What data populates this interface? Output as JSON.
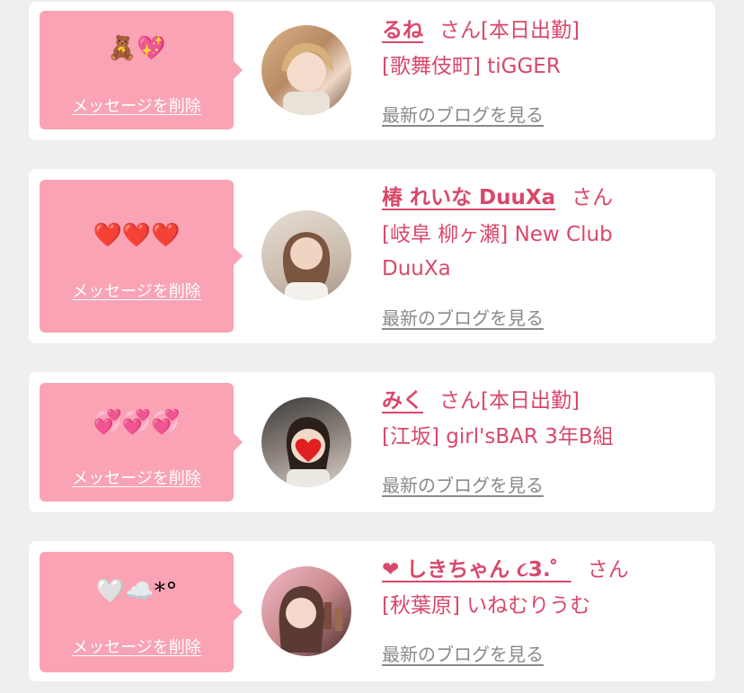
{
  "colors": {
    "accent": "#d9486a",
    "bubble": "#f9a3b4",
    "muted": "#8a8a8a",
    "background": "#efefef"
  },
  "entries": [
    {
      "emoji": "🧸💖",
      "delete_label": "メッセージを削除",
      "name": "るね",
      "suffix": "さん[本日出勤]",
      "shop": "[歌舞伎町] tiGGER",
      "blog_label": "最新のブログを見る"
    },
    {
      "emoji": "❤️❤️❤️",
      "delete_label": "メッセージを削除",
      "name": "椿 れいな DuuXa",
      "suffix": "さん",
      "shop": "[岐阜 柳ヶ瀬] New Club DuuXa",
      "blog_label": "最新のブログを見る"
    },
    {
      "emoji": "💞💞💞",
      "delete_label": "メッセージを削除",
      "name": "みく",
      "suffix": "さん[本日出勤]",
      "shop": "[江坂] girl'sBAR 3年B組",
      "blog_label": "最新のブログを見る"
    },
    {
      "emoji": "🤍☁️*°",
      "delete_label": "メッセージを削除",
      "name": "❤ しきちゃん ૮3.゜",
      "suffix": "さん",
      "shop": "[秋葉原] いねむりうむ",
      "blog_label": "最新のブログを見る"
    }
  ]
}
